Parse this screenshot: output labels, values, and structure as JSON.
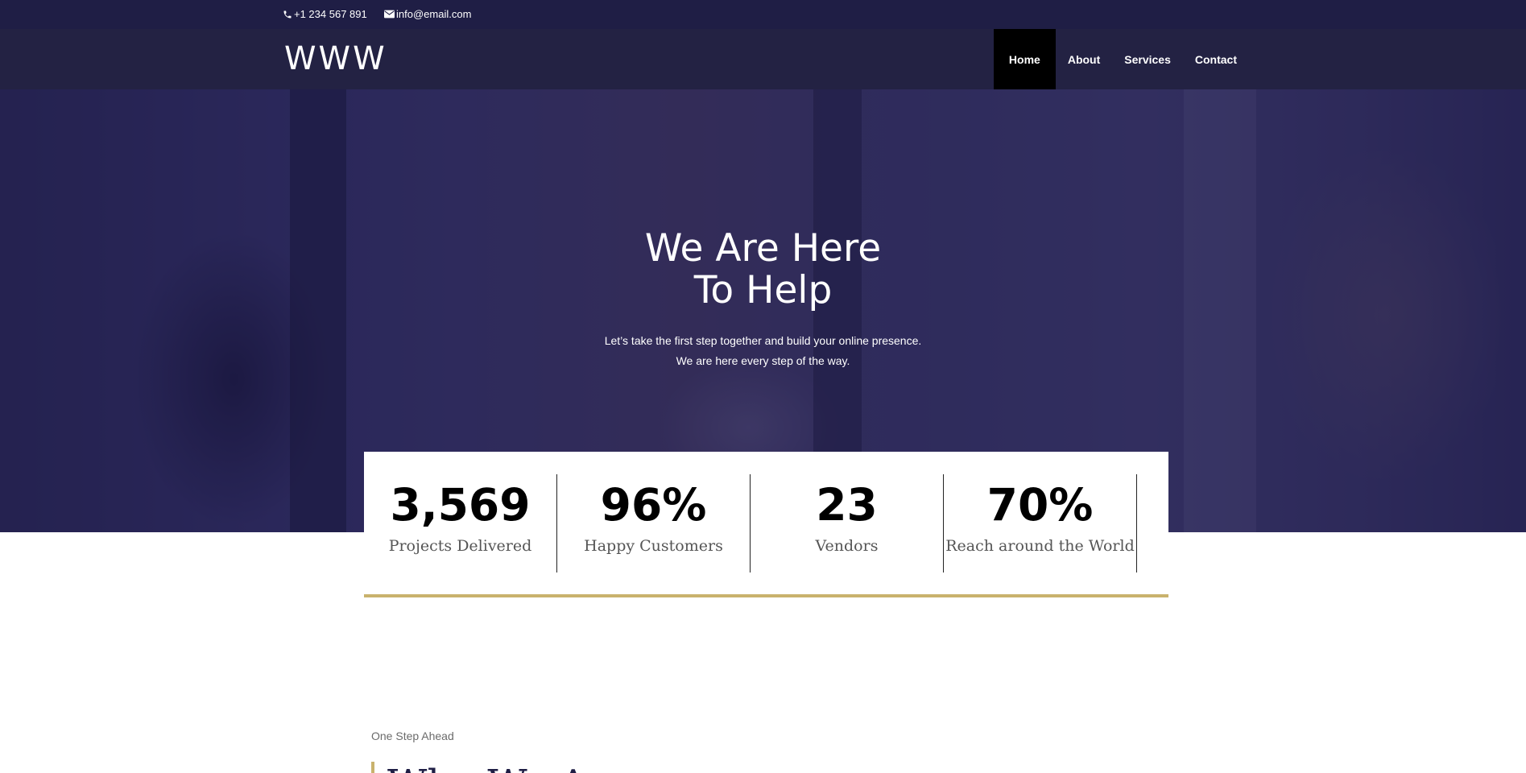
{
  "topbar": {
    "phone": "+1 234 567 891",
    "email": "info@email.com",
    "phone_icon": "phone-icon",
    "email_icon": "envelope-icon"
  },
  "header": {
    "logo": "WWW",
    "nav": [
      {
        "label": "Home",
        "active": true
      },
      {
        "label": "About",
        "active": false
      },
      {
        "label": "Services",
        "active": false
      },
      {
        "label": "Contact",
        "active": false
      }
    ]
  },
  "hero": {
    "title_line1": "We Are Here",
    "title_line2": "To Help",
    "subtitle_line1": "Let’s take the first step together and build your online presence.",
    "subtitle_line2": "We are here every step of the way."
  },
  "stats": [
    {
      "value": "3,569",
      "label": "Projects Delivered"
    },
    {
      "value": "96%",
      "label": "Happy Customers"
    },
    {
      "value": "23",
      "label": "Vendors"
    },
    {
      "value": "70%",
      "label": "Reach around the World"
    }
  ],
  "section": {
    "kicker": "One Step Ahead",
    "heading": "Who We Are"
  },
  "colors": {
    "topbar_bg": "#1f1e45",
    "nav_bg": "#232243",
    "accent_gold": "#c9b26d",
    "active_nav_bg": "#000000"
  }
}
